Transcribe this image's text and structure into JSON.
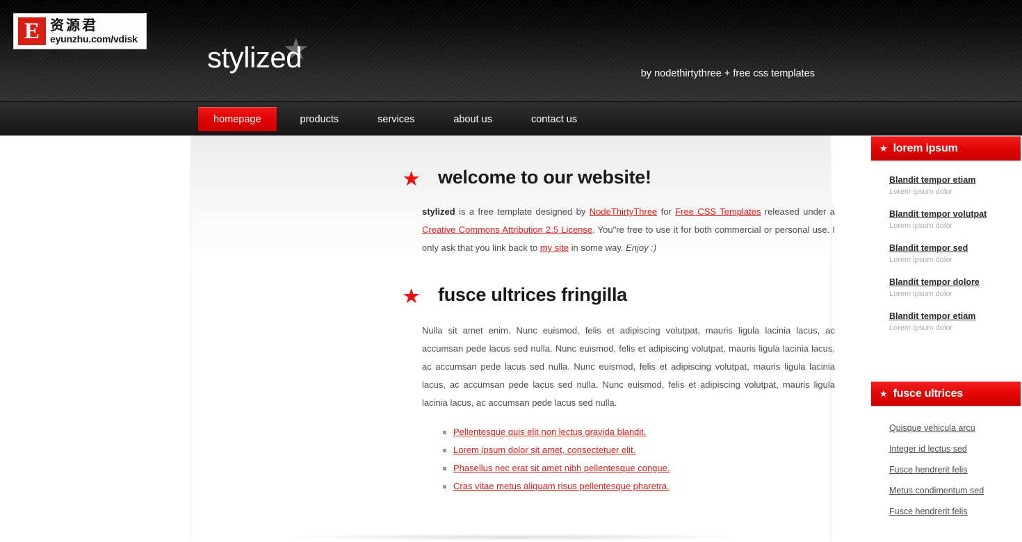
{
  "watermark": {
    "badge_letter": "E",
    "cn_text": "资源君",
    "url_text": "eyunzhu.com/vdisk"
  },
  "header": {
    "site_title": "stylized",
    "star_glyph": "★",
    "byline": "by nodethirtythree + free css templates",
    "bg_color": "#161616",
    "accent_color": "#e00000"
  },
  "nav": {
    "items": [
      {
        "label": "homepage",
        "active": true
      },
      {
        "label": "products",
        "active": false
      },
      {
        "label": "services",
        "active": false
      },
      {
        "label": "about us",
        "active": false
      },
      {
        "label": "contact us",
        "active": false
      }
    ]
  },
  "main": {
    "sections": [
      {
        "heading": "welcome to our website!",
        "star_glyph": "★"
      },
      {
        "heading": "fusce ultrices fringilla",
        "star_glyph": "★"
      }
    ],
    "intro": {
      "bold_lead": "stylized",
      "t1": " is a free template designed by ",
      "link1": "NodeThirtyThree",
      "t2": " for ",
      "link2": "Free CSS Templates",
      "t3": " released under a ",
      "link3": "Creative Commons Attribution 2.5 License",
      "t4": ". You\"re free to use it for both commercial or personal use. I only ask that you link back to ",
      "link4": "my site",
      "t5": " in some way. ",
      "italic_tail": "Enjoy :)"
    },
    "fusce_paragraph": "Nulla sit amet enim. Nunc euismod, felis et adipiscing volutpat, mauris ligula lacinia lacus, ac accumsan pede lacus sed nulla. Nunc euismod, felis et adipiscing volutpat, mauris ligula lacinia lacus, ac accumsan pede lacus sed nulla. Nunc euismod, felis et adipiscing volutpat, mauris ligula lacinia lacus, ac accumsan pede lacus sed nulla. Nunc euismod, felis et adipiscing volutpat, mauris ligula lacinia lacus, ac accumsan pede lacus sed nulla.",
    "bullets": [
      "Pellentesque quis elit non lectus gravida blandit.",
      "Lorem ipsum dolor sit amet, consectetuer elit.",
      "Phasellus nec erat sit amet nibh pellentesque congue.",
      "Cras vitae metus aliquam risus pellentesque pharetra."
    ]
  },
  "sidebar": {
    "box1": {
      "title": "lorem ipsum",
      "star_glyph": "★",
      "entries": [
        {
          "title": "Blandit tempor etiam",
          "sub": "Lorem ipsum dolor"
        },
        {
          "title": "Blandit tempor volutpat",
          "sub": "Lorem ipsum dolor"
        },
        {
          "title": "Blandit tempor sed",
          "sub": "Lorem ipsum dolor"
        },
        {
          "title": "Blandit tempor dolore",
          "sub": "Lorem ipsum dolor"
        },
        {
          "title": "Blandit tempor etiam",
          "sub": "Lorem ipsum dolor"
        }
      ]
    },
    "box2": {
      "title": "fusce ultrices",
      "star_glyph": "★",
      "links": [
        "Quisque vehicula arcu",
        "Integer id lectus sed",
        "Fusce hendrerit felis",
        "Metus condimentum sed",
        "Fusce hendrerit felis"
      ]
    }
  }
}
